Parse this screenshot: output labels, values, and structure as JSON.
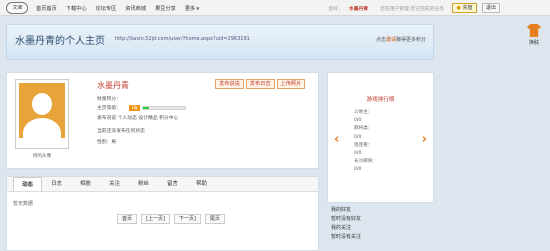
{
  "topbar": {
    "logo": "文库",
    "nav": [
      "首页首页",
      "下载中心",
      "论坛专区",
      "资讯商城",
      "果豆分享",
      "更多"
    ],
    "greeting": "您好，",
    "username": "水墨丹青",
    "notice": "您在用户管理  您已完成的任务",
    "charge_label": "充值",
    "logout_label": "退出"
  },
  "header": {
    "title": "水墨丹青的个人主页",
    "url": "http://kavin.52jd.com/user/?home.aspx?uid=2963191",
    "link_prefix": "点击",
    "link_highlight": "邀请",
    "link_suffix": "赚得更多积分"
  },
  "skin": {
    "label": "换肤"
  },
  "profile": {
    "name": "水墨丹青",
    "avatar_caption": "待的头像",
    "actions": [
      "发布说说",
      "发布日志",
      "上传照片"
    ],
    "level_label": "财富积分：",
    "level_line": "主页等级：",
    "level_badge": "1级",
    "level_progress": 0.15,
    "privacy_line": "发布说说  个人动态  设计精品  积分中心",
    "status_line": "当前还没发布任何状态",
    "gender_line": "性别：男"
  },
  "tabs": [
    "动态",
    "日志",
    "相册",
    "关注",
    "粉丝",
    "留言",
    "帮助"
  ],
  "feed": {
    "no_data": "暂无数据",
    "pager": [
      "首页",
      "[上一页]",
      "下一页]",
      "尾页"
    ]
  },
  "sidebar": {
    "title": "游戏排行榜",
    "lines": [
      "斗地主：",
      "0/0",
      "麻将类：",
      "0/0",
      "连连看：",
      "0/0",
      "长沙麻将：",
      "0/0"
    ],
    "below": [
      "我的好友",
      "暂时没有好友",
      "我的关注",
      "暂时没有关注"
    ]
  },
  "colors": {
    "accent": "#c0392b",
    "orange": "#e67e22",
    "page_bg": "#dde6ee"
  }
}
